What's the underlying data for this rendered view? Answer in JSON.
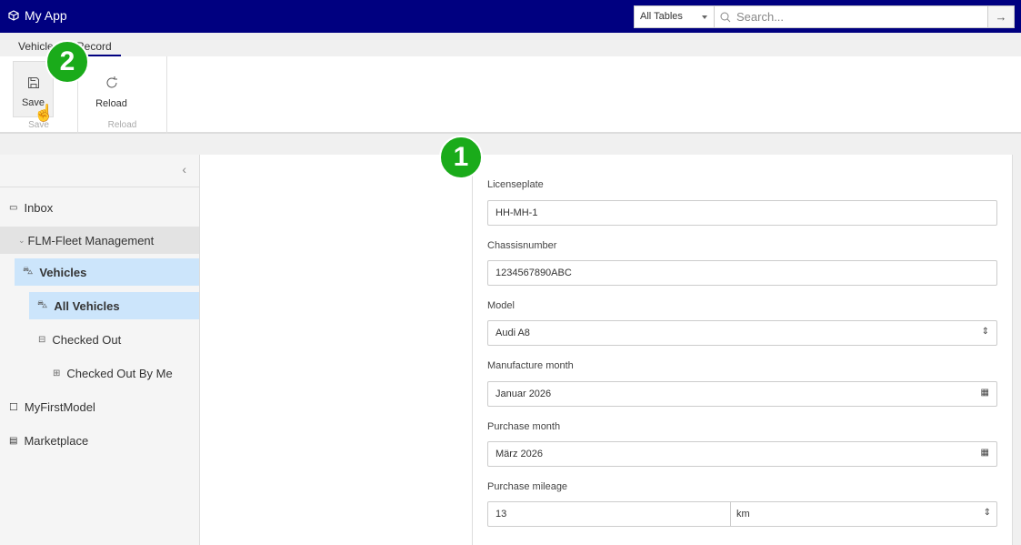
{
  "header": {
    "app_title": "My App",
    "app_icon": "cube-icon",
    "search_scope": "All Tables",
    "search_placeholder": "Search..."
  },
  "tabs": [
    {
      "label": "Vehicles"
    },
    {
      "label": "Record",
      "active": true
    }
  ],
  "ribbon": {
    "groups": [
      {
        "label": "Save",
        "button": "Save"
      },
      {
        "label": "Reload",
        "button": "Reload"
      }
    ]
  },
  "sidebar": {
    "items": [
      {
        "label": "Inbox",
        "icon": "inbox-icon"
      },
      {
        "label": "FLM-Fleet Management",
        "icon": "chevron-down-icon"
      },
      {
        "label": "Vehicles",
        "icon": "car-icon"
      },
      {
        "label": "All Vehicles",
        "icon": "car-icon"
      },
      {
        "label": "Checked Out",
        "icon": "lock-icon"
      },
      {
        "label": "Checked Out By Me",
        "icon": "lock-user-icon"
      },
      {
        "label": "MyFirstModel",
        "icon": "square-icon"
      },
      {
        "label": "Marketplace",
        "icon": "store-icon"
      }
    ]
  },
  "form": {
    "fields": [
      {
        "label": "Licenseplate",
        "value": "HH-MH-1"
      },
      {
        "label": "Chassisnumber",
        "value": "1234567890ABC"
      },
      {
        "label": "Model",
        "value": "Audi A8"
      },
      {
        "label": "Manufacture month",
        "value": "Januar 2026"
      },
      {
        "label": "Purchase month",
        "value": "März 2026"
      },
      {
        "label": "Purchase mileage",
        "value": "13",
        "unit": "km"
      }
    ]
  },
  "annotations": {
    "badge1": "1",
    "badge2": "2"
  },
  "colors": {
    "header": "#000080",
    "selected": "#cce5fb",
    "badge": "#1aab1a"
  }
}
